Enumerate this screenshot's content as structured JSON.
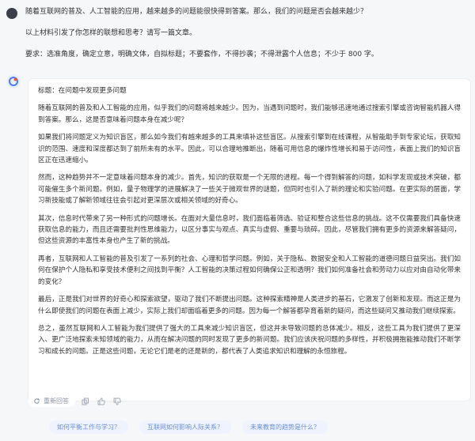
{
  "user": {
    "lines": [
      "随着互联网的普及、人工智能的应用，越来越多的问题能很快得到答案。那么，我们的问题是否会越来越少？",
      "以上材料引发了你怎样的联想和思考？请写一篇文章。",
      "要求：选准角度，确定立意，明确文体，自拟标题；不要套作，不得抄袭；不得泄露个人信息；不少于 800 字。"
    ]
  },
  "answer": {
    "paragraphs": [
      "标题：在问题中发现更多问题",
      "随着互联网的普及和人工智能的应用，似乎我们的问题将越来越少。因为，当遇到问题时，我们能够迅速地通过搜索引擎或咨询智能机器人得到答案。那么，这是否意味着问题本身在减少呢？",
      "如果我们将问题定义为知识盲区，那么如今我们有越来越多的工具来填补这些盲区。从搜索引擎到在线课程，从智能助手到专家论坛，获取知识的范围、速度和深度都达到了前所未有的水平。因此，可以合理地推断出，随着可用信息的爆炸性增长和易于访问性，表面上我们的知识盲区正在迅速缩小。",
      "然而，这种趋势并不一定意味着问题本身的减少。首先，知识的获取是一个无限的进程。每一个得到解答的问题，如科学发现或技术突破，都可能催生多个新问题。例如，量子物理学的进展解决了一些关于微观世界的谜题，但同时也引入了新的理论和实验问题。在更实际的层面，学习新技能或了解新领域往往会引起对更深层次或相关领域的好奇心。",
      "其次，信息时代带来了另一种形式的问题增长。在面对大量信息时，我们面临着筛选、验证和整合这些信息的挑战。这不仅需要我们具备快速获取信息的能力，而且还需要批判性思维能力，以区分事实与观点、真实与虚假、重要与琐碎。因此，尽管我们拥有更多的资源来解答疑问，但这些资源的丰富性本身也产生了新的挑战。",
      "再者，互联网和人工智能的普及引发了一系列的社会、心理和哲学问题。例如，关于隐私、数据安全和人工智能的道德问题日益突出。我们如何在保护个人隐私和享受技术便利之间找到平衡？人工智能的决策过程如何确保公正和透明？我们如何准备社会和劳动力以应对由自动化带来的变化？",
      "最后，正是我们对世界的好奇心和探索欲望，驱动了我们不断提出问题。这种探索精神是人类进步的基石，它激发了创新和发现。而这正是为什么即使我们的问题在表面上减少，实际上我们却面临着更多的问题。因为每一个解答都孕育着新的疑问，而这些疑问又推动我们继续探索。",
      "总之，虽然互联网和人工智能为我们提供了强大的工具来减少知识盲区，但这并未导致问题的总体减少。相反，这些工具为我们提供了更深入、更广泛地探索未知领域的能力，从而在解决问题的同时发现了更多的新问题。我们应该庆祝问题的多样性，并积极拥抱能推动我们不断学习和成长的问题。正是这些问题，无论它们是老的还是新的，都代表了人类追求知识和理解的永恒旅程。"
    ]
  },
  "actions": {
    "reload_label": "重新回答"
  },
  "suggestions": [
    "如何平衡工作与学习？",
    "互联网如何影响人际关系？",
    "未来教育的趋势是什么？"
  ],
  "colors": {
    "accent": "#6b8fd6",
    "card_bg": "#ffffff",
    "page_bg": "#f6f7f9"
  }
}
